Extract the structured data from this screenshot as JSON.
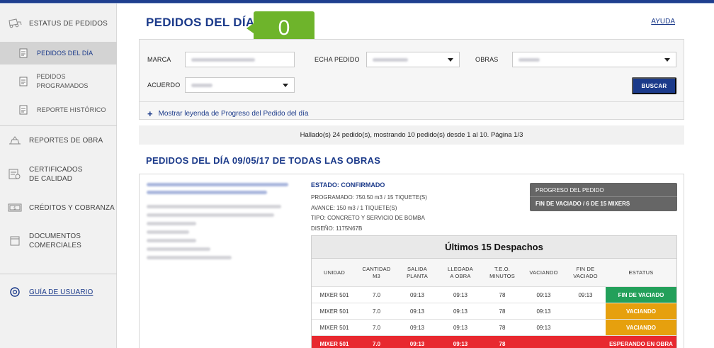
{
  "sidebar": {
    "items": [
      {
        "label": "ESTATUS DE PEDIDOS",
        "icon": "truck-icon"
      },
      {
        "label": "PEDIDOS DEL DÍA",
        "icon": "document-icon",
        "active": true
      },
      {
        "label": "PEDIDOS PROGRAMADOS",
        "icon": "document-icon"
      },
      {
        "label": "REPORTE HISTÓRICO",
        "icon": "document-icon"
      },
      {
        "label": "REPORTES DE OBRA",
        "icon": "construction-icon"
      },
      {
        "label": "CERTIFICADOS\nDE CALIDAD",
        "icon": "certificate-icon"
      },
      {
        "label": "CRÉDITOS Y COBRANZA",
        "icon": "money-icon"
      },
      {
        "label": "DOCUMENTOS\nCOMERCIALES",
        "icon": "folder-icon"
      }
    ],
    "guide_label": "GUÍA DE USUARIO"
  },
  "header": {
    "title": "PEDIDOS DEL DÍA",
    "help": "AYUDA",
    "badge": "0"
  },
  "filters": {
    "marca_label": "MARCA",
    "fecha_label": "ECHA PEDIDO",
    "obras_label": "OBRAS",
    "acuerdo_label": "ACUERDO",
    "search_button": "BUSCAR",
    "legend_link": "Mostrar leyenda de Progreso del Pedido del día"
  },
  "results": {
    "summary": "Hallado(s) 24 pedido(s), mostrando 10 pedido(s) desde 1 al 10. Página 1/3"
  },
  "section": {
    "title": "PEDIDOS DEL DÍA 09/05/17 DE TODAS LAS OBRAS"
  },
  "order": {
    "estado": "ESTADO: CONFIRMADO",
    "programado": "PROGRAMADO: 750.50 m3 / 15 TIQUETE(S)",
    "avance": "AVANCE: 150 m3 / 1 TIQUETE(S)",
    "tipo": "TIPO: CONCRETO Y SERVICIO DE BOMBA",
    "diseno": "DISEÑO: 1175N67B",
    "progress_title": "PROGRESO DEL PEDIDO",
    "progress_value": "FIN DE VACIADO  / 6 DE 15 MIXERS"
  },
  "dispatch": {
    "title": "Últimos 15 Despachos",
    "columns": [
      "UNIDAD",
      "CANTIDAD\nM3",
      "SALIDA\nPLANTA",
      "LLEGADA\nA OBRA",
      "T.E.O.\nMINUTOS",
      "VACIANDO",
      "FIN DE\nVACIADO",
      "ESTATUS"
    ],
    "rows": [
      {
        "unidad": "MIXER 501",
        "cantidad": "7.0",
        "salida": "09:13",
        "llegada": "09:13",
        "teo": "78",
        "vaciando": "09:13",
        "fin": "09:13",
        "estatus": "FIN DE VACIADO",
        "color": "#23a05a"
      },
      {
        "unidad": "MIXER 501",
        "cantidad": "7.0",
        "salida": "09:13",
        "llegada": "09:13",
        "teo": "78",
        "vaciando": "09:13",
        "fin": "",
        "estatus": "VACIANDO",
        "color": "#e6a00e"
      },
      {
        "unidad": "MIXER 501",
        "cantidad": "7.0",
        "salida": "09:13",
        "llegada": "09:13",
        "teo": "78",
        "vaciando": "09:13",
        "fin": "",
        "estatus": "VACIANDO",
        "color": "#e6a00e"
      },
      {
        "unidad": "MIXER 501",
        "cantidad": "7.0",
        "salida": "09:13",
        "llegada": "09:13",
        "teo": "78",
        "vaciando": "",
        "fin": "",
        "estatus": "ESPERANDO EN OBRA",
        "color": "#e8282f"
      }
    ]
  },
  "colors": {
    "brand": "#1b3a8a",
    "badge": "#6eb42b"
  }
}
